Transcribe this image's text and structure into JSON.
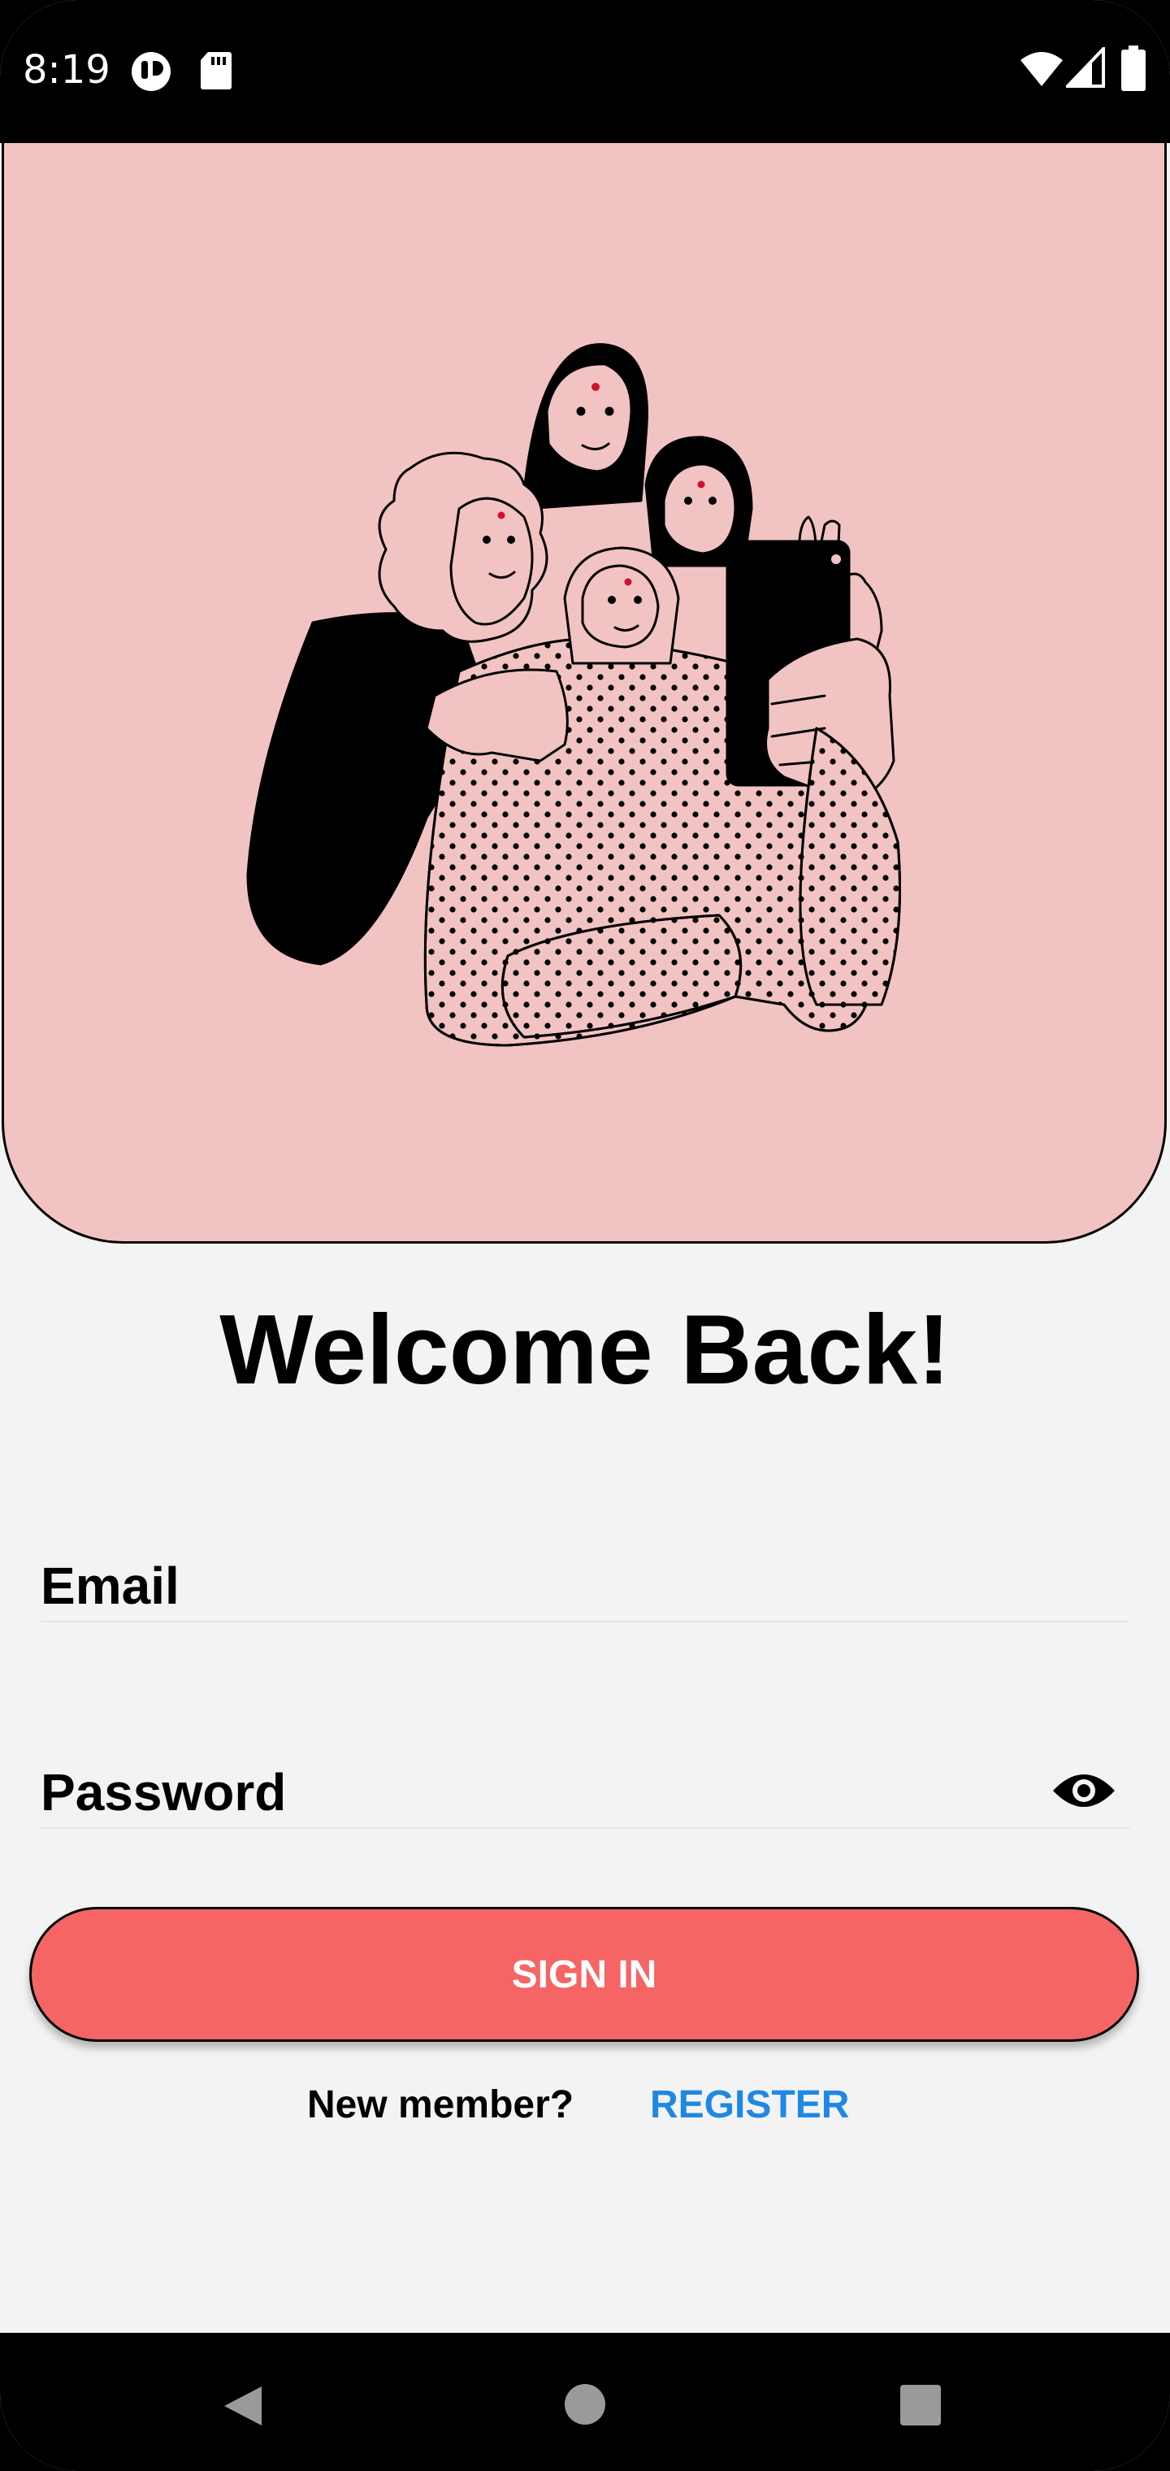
{
  "status_bar": {
    "time": "8:19",
    "icons": [
      "app-notification-icon",
      "sd-card-icon",
      "wifi-icon",
      "signal-icon",
      "battery-icon"
    ]
  },
  "hero": {
    "illustration": "group-selfie-illustration",
    "background_color": "#f2c3c3"
  },
  "title": "Welcome Back!",
  "form": {
    "email_label": "Email",
    "password_label": "Password",
    "password_toggle_icon": "eye-icon"
  },
  "signin_button": {
    "label": "SIGN IN",
    "color": "#f56565"
  },
  "footer": {
    "prompt": "New member?",
    "register_link": "REGISTER",
    "link_color": "#1e88e5"
  },
  "nav_bar": {
    "icons": [
      "back-icon",
      "home-icon",
      "recents-icon"
    ]
  }
}
